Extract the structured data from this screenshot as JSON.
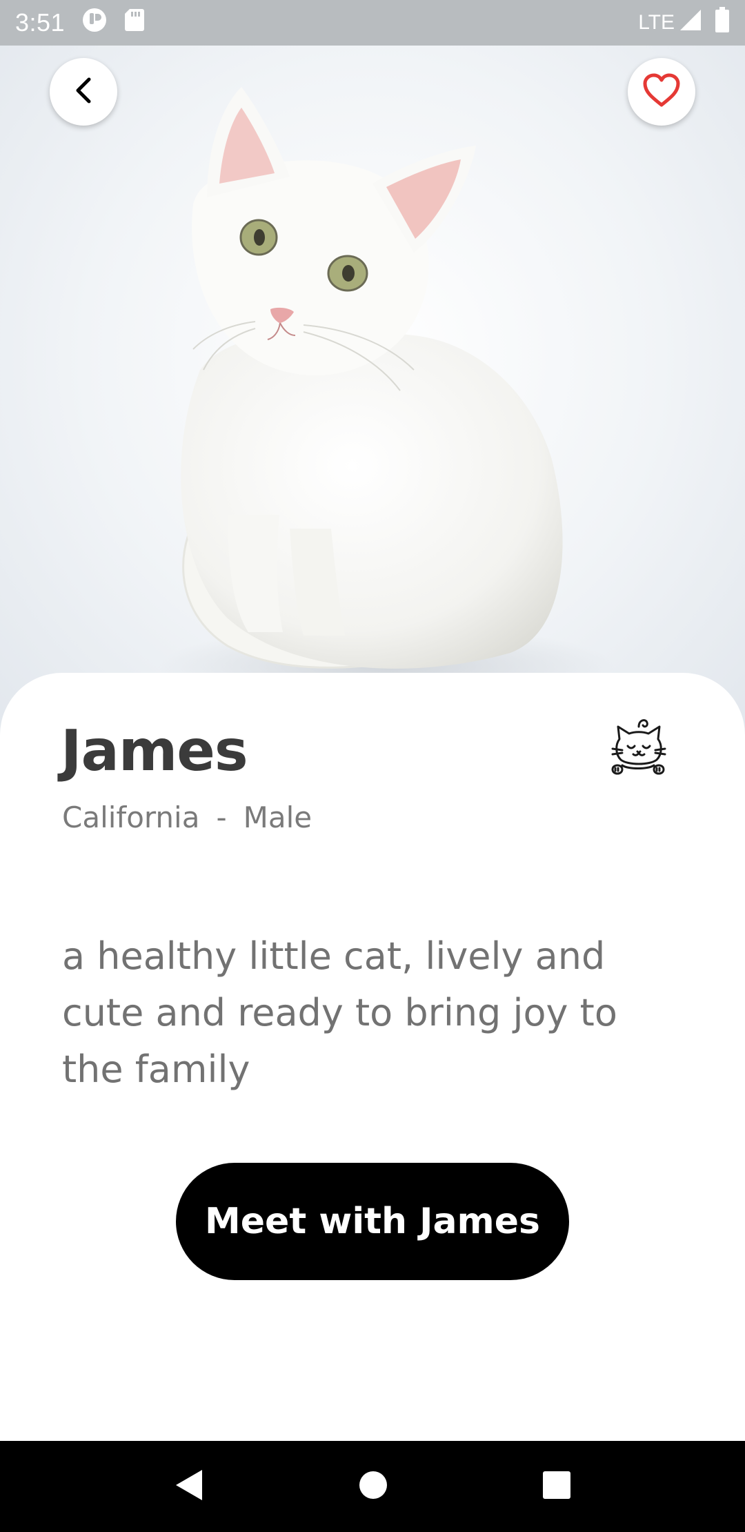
{
  "status_bar": {
    "time": "3:51",
    "network": "LTE",
    "icons": [
      "notification-app-icon",
      "sd-card-icon",
      "signal-icon",
      "battery-icon"
    ]
  },
  "hero": {
    "image": "white-cat-photo",
    "back_icon": "chevron-left-icon",
    "favorite_icon": "heart-outline-icon",
    "favorite_color": "#e53935"
  },
  "pet": {
    "name": "James",
    "location": "California",
    "separator": "-",
    "gender": "Male",
    "type_icon": "cat-icon",
    "description": "a healthy little cat, lively and cute and ready to bring joy to the family"
  },
  "actions": {
    "meet_label": "Meet with James"
  },
  "nav_bar": {
    "icons": [
      "back-triangle-icon",
      "home-circle-icon",
      "recents-square-icon"
    ]
  }
}
